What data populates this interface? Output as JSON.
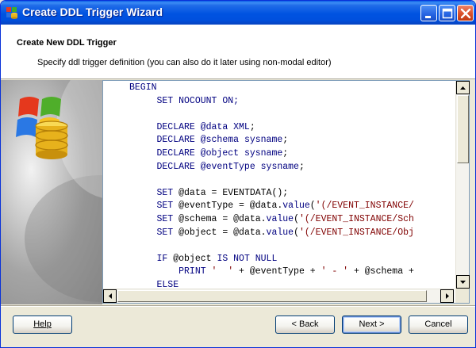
{
  "window": {
    "title": "Create DDL Trigger Wizard"
  },
  "header": {
    "title": "Create New DDL Trigger",
    "subtitle": "Specify ddl trigger definition (you can also do it later using non-modal editor)"
  },
  "editor": {
    "lines": [
      [
        {
          "t": "BEGIN",
          "c": "kw"
        }
      ],
      [
        {
          "t": "     SET NOCOUNT ON;",
          "c": "kw"
        }
      ],
      [
        {
          "t": "",
          "c": "op"
        }
      ],
      [
        {
          "t": "     DECLARE @data ",
          "c": "kw"
        },
        {
          "t": "XML",
          "c": "ty"
        },
        {
          "t": ";",
          "c": "op"
        }
      ],
      [
        {
          "t": "     DECLARE @schema ",
          "c": "kw"
        },
        {
          "t": "sysname",
          "c": "ty"
        },
        {
          "t": ";",
          "c": "op"
        }
      ],
      [
        {
          "t": "     DECLARE @object ",
          "c": "kw"
        },
        {
          "t": "sysname",
          "c": "ty"
        },
        {
          "t": ";",
          "c": "op"
        }
      ],
      [
        {
          "t": "     DECLARE @eventType ",
          "c": "kw"
        },
        {
          "t": "sysname",
          "c": "ty"
        },
        {
          "t": ";",
          "c": "op"
        }
      ],
      [
        {
          "t": "",
          "c": "op"
        }
      ],
      [
        {
          "t": "     SET ",
          "c": "kw"
        },
        {
          "t": "@data = EVENTDATA();",
          "c": "op"
        }
      ],
      [
        {
          "t": "     SET ",
          "c": "kw"
        },
        {
          "t": "@eventType = @data.",
          "c": "op"
        },
        {
          "t": "value",
          "c": "kw"
        },
        {
          "t": "(",
          "c": "op"
        },
        {
          "t": "'(/EVENT_INSTANCE/",
          "c": "st"
        }
      ],
      [
        {
          "t": "     SET ",
          "c": "kw"
        },
        {
          "t": "@schema = @data.",
          "c": "op"
        },
        {
          "t": "value",
          "c": "kw"
        },
        {
          "t": "(",
          "c": "op"
        },
        {
          "t": "'(/EVENT_INSTANCE/Sch",
          "c": "st"
        }
      ],
      [
        {
          "t": "     SET ",
          "c": "kw"
        },
        {
          "t": "@object = @data.",
          "c": "op"
        },
        {
          "t": "value",
          "c": "kw"
        },
        {
          "t": "(",
          "c": "op"
        },
        {
          "t": "'(/EVENT_INSTANCE/Obj",
          "c": "st"
        }
      ],
      [
        {
          "t": "",
          "c": "op"
        }
      ],
      [
        {
          "t": "     IF ",
          "c": "kw"
        },
        {
          "t": "@object ",
          "c": "op"
        },
        {
          "t": "IS NOT NULL",
          "c": "kw"
        }
      ],
      [
        {
          "t": "         PRINT ",
          "c": "kw"
        },
        {
          "t": "'  '",
          "c": "st"
        },
        {
          "t": " + @eventType + ",
          "c": "op"
        },
        {
          "t": "' - '",
          "c": "st"
        },
        {
          "t": " + @schema +",
          "c": "op"
        }
      ],
      [
        {
          "t": "     ELSE",
          "c": "kw"
        }
      ]
    ]
  },
  "buttons": {
    "help": "Help",
    "back": "< Back",
    "next": "Next >",
    "cancel": "Cancel"
  },
  "icons": {
    "app": "ddl-wizard-icon",
    "minimize": "minimize-icon",
    "maximize": "maximize-icon",
    "close": "close-icon",
    "wizard_graphic": "database-logo-icon"
  }
}
